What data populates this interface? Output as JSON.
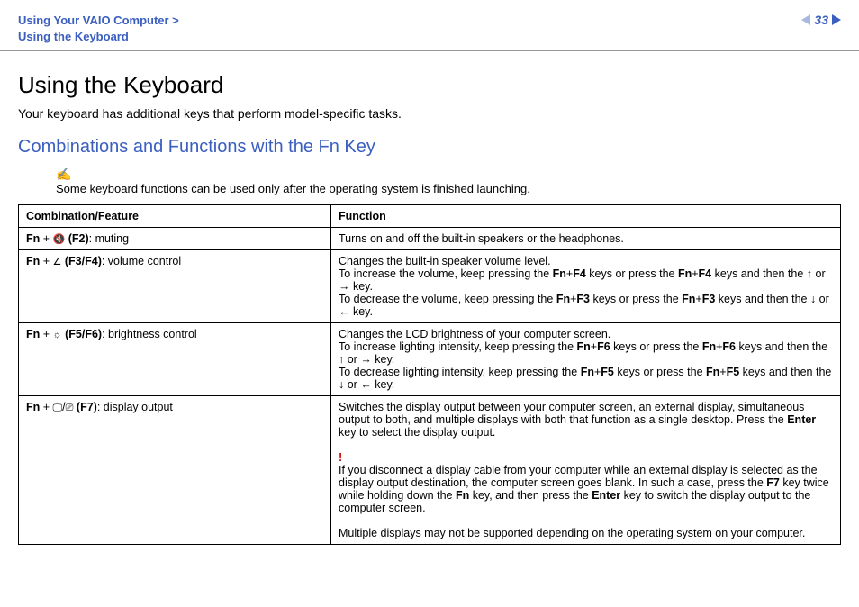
{
  "header": {
    "breadcrumb_line1": "Using Your VAIO Computer >",
    "breadcrumb_line2": "Using the Keyboard",
    "page_number": "33"
  },
  "title": "Using the Keyboard",
  "intro": "Your keyboard has additional keys that perform model-specific tasks.",
  "subhead": "Combinations and Functions with the Fn Key",
  "note_icon": "✍",
  "note_text": "Some keyboard functions can be used only after the operating system is finished launching.",
  "table": {
    "head_combo": "Combination/Feature",
    "head_func": "Function",
    "r1": {
      "fn": "Fn",
      "plus": " + ",
      "icon": "🔇",
      "key": " (F2)",
      "label": ": muting",
      "func": "Turns on and off the built-in speakers or the headphones."
    },
    "r2": {
      "fn": "Fn",
      "plus": " + ",
      "icon": "∠",
      "key": " (F3/F4)",
      "label": ": volume control",
      "f_line1": "Changes the built-in speaker volume level.",
      "f_inc_a": "To increase the volume, keep pressing the ",
      "f_inc_b": "Fn",
      "f_inc_c": "+",
      "f_inc_d": "F4",
      "f_inc_e": " keys or press the ",
      "f_inc_f": "Fn",
      "f_inc_g": "+",
      "f_inc_h": "F4",
      "f_inc_i": " keys and then the ",
      "f_inc_up": "↑",
      "f_inc_or": " or ",
      "f_inc_right": "→",
      "f_inc_end": " key.",
      "f_dec_a": "To decrease the volume, keep pressing the ",
      "f_dec_b": "Fn",
      "f_dec_c": "+",
      "f_dec_d": "F3",
      "f_dec_e": " keys or press the ",
      "f_dec_f": "Fn",
      "f_dec_g": "+",
      "f_dec_h": "F3",
      "f_dec_i": " keys and then the ",
      "f_dec_down": "↓",
      "f_dec_or": " or ",
      "f_dec_left": "←",
      "f_dec_end": " key."
    },
    "r3": {
      "fn": "Fn",
      "plus": " + ",
      "icon": "☼",
      "key": " (F5/F6)",
      "label": ": brightness control",
      "f_line1": "Changes the LCD brightness of your computer screen.",
      "f_inc_a": "To increase lighting intensity, keep pressing the ",
      "f_inc_b": "Fn",
      "f_inc_c": "+",
      "f_inc_d": "F6",
      "f_inc_e": " keys or press the ",
      "f_inc_f": "Fn",
      "f_inc_g": "+",
      "f_inc_h": "F6",
      "f_inc_i": " keys and then the ",
      "f_inc_up": "↑",
      "f_inc_or": " or ",
      "f_inc_right": "→",
      "f_inc_end": " key.",
      "f_dec_a": "To decrease lighting intensity, keep pressing the ",
      "f_dec_b": "Fn",
      "f_dec_c": "+",
      "f_dec_d": "F5",
      "f_dec_e": " keys or press the ",
      "f_dec_f": "Fn",
      "f_dec_g": "+",
      "f_dec_h": "F5",
      "f_dec_i": " keys and then the ",
      "f_dec_down": "↓",
      "f_dec_or": " or ",
      "f_dec_left": "←",
      "f_dec_end": " key."
    },
    "r4": {
      "fn": "Fn",
      "plus": " + ",
      "icon1": "🖵",
      "slash": "/",
      "icon2": "⎚",
      "key": " (F7)",
      "label": ": display output",
      "f_p1_a": "Switches the display output between your computer screen, an external display, simultaneous output to both, and multiple displays with both that function as a single desktop. Press the ",
      "f_p1_b": "Enter",
      "f_p1_c": " key to select the display output.",
      "warn": "!",
      "f_p2_a": "If you disconnect a display cable from your computer while an external display is selected as the display output destination, the computer screen goes blank. In such a case, press the ",
      "f_p2_b": "F7",
      "f_p2_c": " key twice while holding down the ",
      "f_p2_d": "Fn",
      "f_p2_e": " key, and then press the ",
      "f_p2_f": "Enter",
      "f_p2_g": " key to switch the display output to the computer screen.",
      "f_p3": "Multiple displays may not be supported depending on the operating system on your computer."
    }
  }
}
